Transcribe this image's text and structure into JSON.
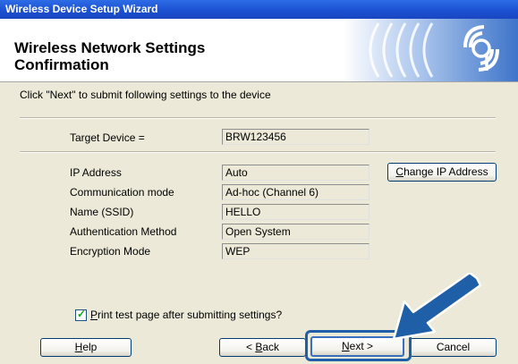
{
  "window": {
    "title": "Wireless Device Setup Wizard"
  },
  "header": {
    "title_line1": "Wireless Network Settings",
    "title_line2": "Confirmation",
    "logo_icon": "wireless-signal-icon"
  },
  "instruction": "Click \"Next\" to submit following settings to the device",
  "fields": {
    "target_device": {
      "label": "Target Device =",
      "value": "BRW123456"
    },
    "ip_address": {
      "label": "IP Address",
      "value": "Auto"
    },
    "communication_mode": {
      "label": "Communication mode",
      "value": "Ad-hoc (Channel 6)"
    },
    "ssid": {
      "label": "Name (SSID)",
      "value": "HELLO"
    },
    "authentication": {
      "label": "Authentication Method",
      "value": "Open System"
    },
    "encryption": {
      "label": "Encryption Mode",
      "value": "WEP"
    }
  },
  "buttons": {
    "change_ip": {
      "pre": "",
      "key": "C",
      "post": "hange IP Address"
    },
    "help": {
      "pre": "",
      "key": "H",
      "post": "elp"
    },
    "back": {
      "pre": "< ",
      "key": "B",
      "post": "ack"
    },
    "next": {
      "pre": "",
      "key": "N",
      "post": "ext >"
    },
    "cancel": "Cancel"
  },
  "print_test": {
    "checked": true,
    "key": "P",
    "label_rest": "rint test page after submitting settings?"
  },
  "colors": {
    "accent": "#1f5fa8",
    "titlebar": "#1b4fd0",
    "arrow": "#1f5fa8"
  }
}
